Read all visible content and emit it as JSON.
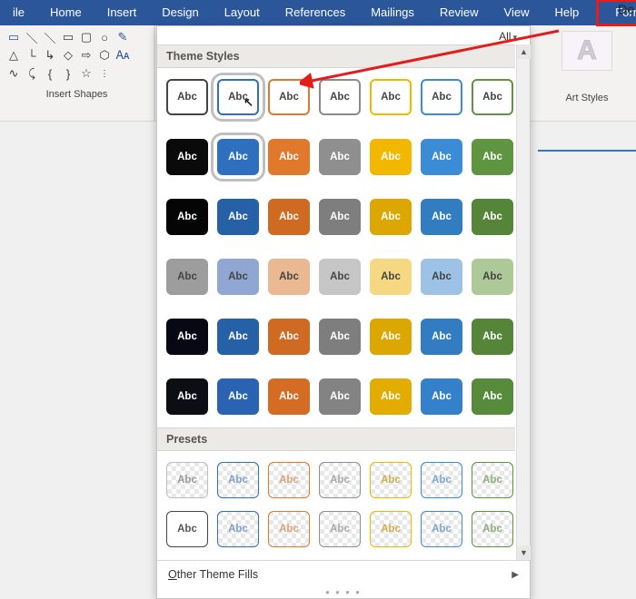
{
  "ribbon": {
    "tabs": [
      "ile",
      "Home",
      "Insert",
      "Design",
      "Layout",
      "References",
      "Mailings",
      "Review",
      "View",
      "Help",
      "Format"
    ]
  },
  "shapes_group_label": "Insert Shapes",
  "wordart": {
    "sample": "A",
    "label": "Art Styles"
  },
  "gallery": {
    "all_label": "All",
    "theme_header": "Theme Styles",
    "presets_header": "Presets",
    "swatch_label": "Abc",
    "other_fills_prefix": "O",
    "other_fills_rest": "ther Theme Fills"
  },
  "partial_text": "De"
}
